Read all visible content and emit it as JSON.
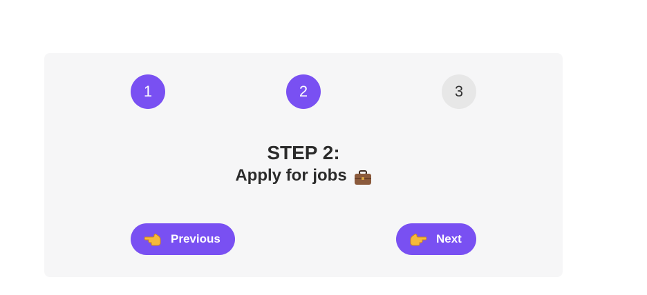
{
  "steps": [
    {
      "number": "1",
      "state": "active"
    },
    {
      "number": "2",
      "state": "active"
    },
    {
      "number": "3",
      "state": "inactive"
    }
  ],
  "message": {
    "title": "STEP 2:",
    "subtitle": "Apply for jobs",
    "icon": "briefcase-icon"
  },
  "buttons": {
    "previous": {
      "label": "Previous",
      "icon": "hand-pointing-left-icon"
    },
    "next": {
      "label": "Next",
      "icon": "hand-pointing-right-icon"
    }
  },
  "colors": {
    "accent": "#7950f2",
    "inactive": "#e7e7e7",
    "card": "#f6f6f7",
    "text": "#2b2b2b"
  }
}
